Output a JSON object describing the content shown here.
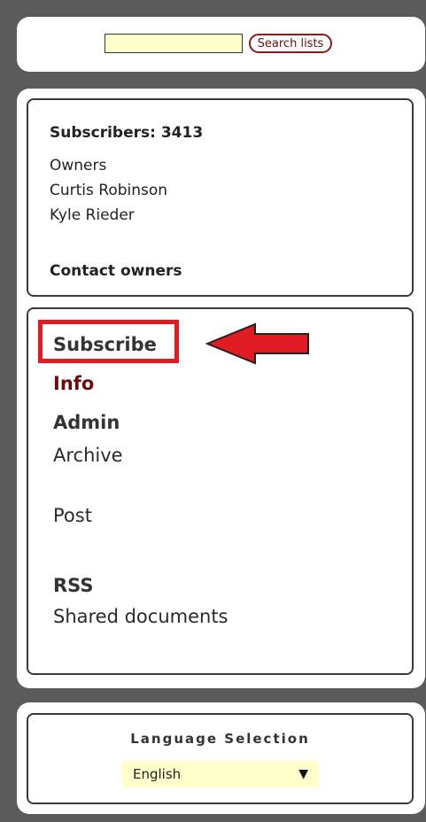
{
  "search": {
    "placeholder": "",
    "value": "",
    "button_label": "Search lists"
  },
  "list_info": {
    "subscribers": "Subscribers: 3413",
    "owners_title": "Owners",
    "owners": [
      "Curtis Robinson",
      "Kyle Rieder"
    ],
    "contact_owners": "Contact owners"
  },
  "menu": {
    "subscribe": "Subscribe",
    "info": "Info",
    "admin": "Admin",
    "archive": "Archive",
    "post": "Post",
    "rss": "RSS",
    "shared_documents": "Shared documents"
  },
  "annotation": {
    "highlight_color": "#e01b24",
    "arrow_icon": "left-arrow-icon"
  },
  "language": {
    "title": "Language Selection",
    "selected": "English",
    "caret": "▼"
  },
  "colors": {
    "background": "#5b5b5b",
    "input_background": "#ffffcc",
    "link_accent": "#6a0d0d"
  }
}
